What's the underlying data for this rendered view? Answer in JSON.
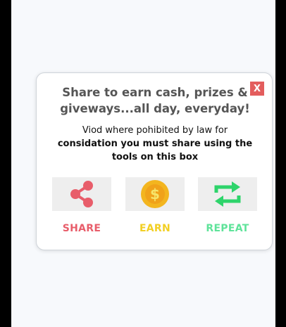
{
  "modal": {
    "close_label": "X",
    "title": "Share to earn cash, prizes & giveways...all day, everyday!",
    "desc_line1": "Viod where pohibited by law for",
    "desc_bold": "considation you must share using the tools on this box"
  },
  "actions": [
    {
      "label": "SHARE",
      "icon": "share-icon",
      "color": "#e85d6a"
    },
    {
      "label": "EARN",
      "icon": "coin-icon",
      "color": "#f2cf24"
    },
    {
      "label": "REPEAT",
      "icon": "repeat-icon",
      "color": "#5fe39a"
    }
  ]
}
